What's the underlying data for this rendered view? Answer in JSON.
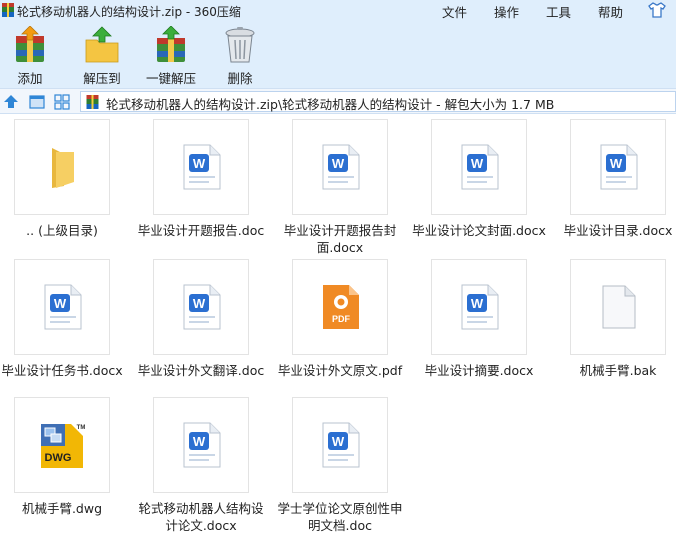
{
  "window": {
    "title": "轮式移动机器人的结构设计.zip - 360压缩",
    "menu": {
      "file": "文件",
      "operate": "操作",
      "tools": "工具",
      "help": "帮助"
    }
  },
  "toolbar": {
    "add": "添加",
    "extract_to": "解压到",
    "one_click_extract": "一键解压",
    "delete": "删除"
  },
  "address": {
    "path": "轮式移动机器人的结构设计.zip\\轮式移动机器人的结构设计 - 解包大小为 1.7 MB"
  },
  "files": [
    {
      "name": ".. (上级目录)",
      "type": "folder"
    },
    {
      "name": "毕业设计开题报告.doc",
      "type": "word"
    },
    {
      "name": "毕业设计开题报告封面.docx",
      "type": "word"
    },
    {
      "name": "毕业设计论文封面.docx",
      "type": "word"
    },
    {
      "name": "毕业设计目录.docx",
      "type": "word"
    },
    {
      "name": "毕业设计任务书.docx",
      "type": "word"
    },
    {
      "name": "毕业设计外文翻译.doc",
      "type": "word"
    },
    {
      "name": "毕业设计外文原文.pdf",
      "type": "pdf"
    },
    {
      "name": "毕业设计摘要.docx",
      "type": "word"
    },
    {
      "name": "机械手臂.bak",
      "type": "blank"
    },
    {
      "name": "机械手臂.dwg",
      "type": "dwg"
    },
    {
      "name": "轮式移动机器人结构设计论文.docx",
      "type": "word"
    },
    {
      "name": "学士学位论文原创性申明文档.doc",
      "type": "word"
    }
  ],
  "icons": {
    "app": "archive-icon",
    "word_badge": "W",
    "pdf_badge": "PDF",
    "dwg_badge": "DWG",
    "dwg_tm": "TM"
  },
  "colors": {
    "chrome_bg": "#dfeefc",
    "word_blue": "#2b6fd1",
    "pdf_orange": "#f08a24",
    "folder_yellow": "#f6cf63"
  }
}
